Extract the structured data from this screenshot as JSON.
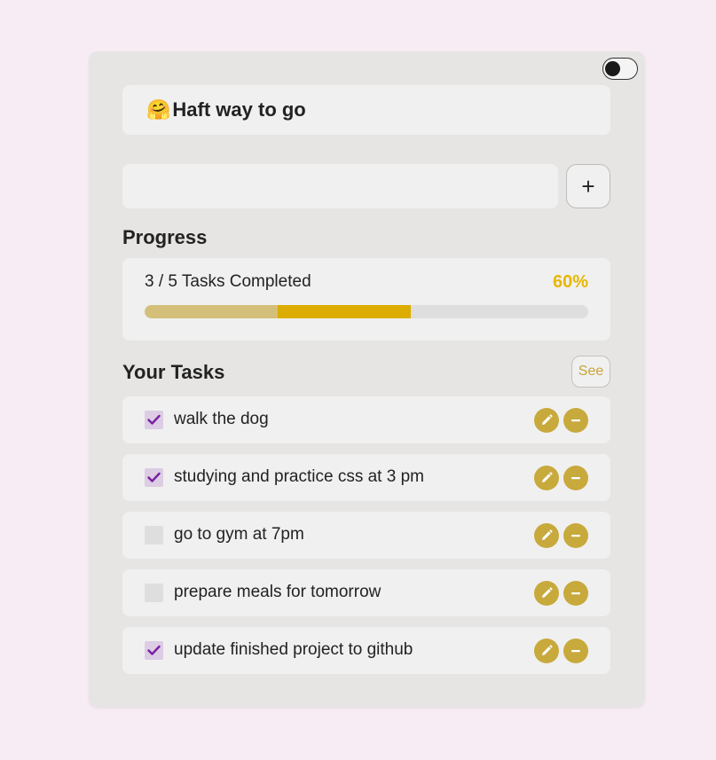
{
  "header": {
    "emoji": "🤗",
    "title": "Haft way to go"
  },
  "theme_toggle": {
    "state": "off"
  },
  "add_task": {
    "input_value": "",
    "placeholder": "",
    "button_label": "+"
  },
  "progress": {
    "title": "Progress",
    "summary": "3 / 5 Tasks Completed",
    "percent_label": "60%",
    "completed": 3,
    "total": 5,
    "fraction": 0.6
  },
  "tasks_section": {
    "title": "Your Tasks",
    "see_label": "See"
  },
  "tasks": [
    {
      "label": "walk the dog",
      "done": true
    },
    {
      "label": "studying and practice css at 3 pm",
      "done": true
    },
    {
      "label": "go to gym at 7pm",
      "done": false
    },
    {
      "label": "prepare meals for tomorrow",
      "done": false
    },
    {
      "label": "update finished project to github",
      "done": true
    }
  ],
  "colors": {
    "page_bg": "#f8ecf4",
    "card_bg": "#e6e5e3",
    "accent_gold": "#c8a93c",
    "percent_text": "#e8b700",
    "bar_fill_light": "#d4bf7a",
    "bar_fill_dark": "#dcac00",
    "check_color": "#7a1fa2"
  },
  "icons": {
    "edit": "pencil-icon",
    "delete": "minus-icon",
    "check": "checkmark-icon"
  }
}
